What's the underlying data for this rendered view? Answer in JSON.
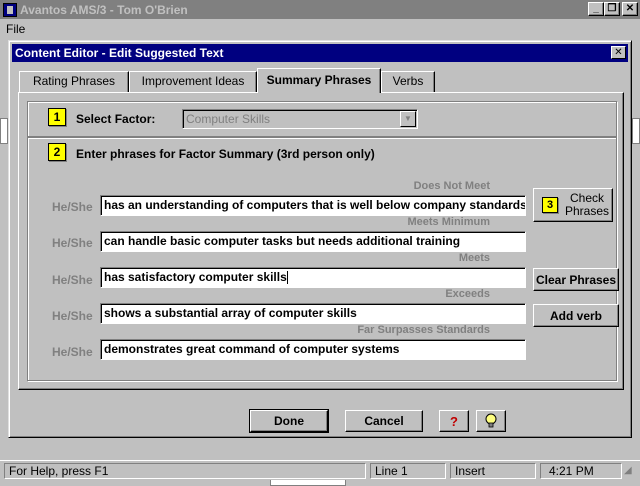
{
  "app": {
    "title": "Avantos AMS/3 - Tom O'Brien",
    "menu": {
      "file": "File"
    },
    "window_buttons": {
      "minimize": "_",
      "restore": "❐",
      "close": "✕"
    }
  },
  "dialog": {
    "title": "Content Editor - Edit Suggested Text",
    "close": "✕",
    "tabs": [
      {
        "label": "Rating Phrases",
        "active": false
      },
      {
        "label": "Improvement Ideas",
        "active": false
      },
      {
        "label": "Summary Phrases",
        "active": true
      },
      {
        "label": "Verbs",
        "active": false
      }
    ],
    "step1": {
      "number": "1",
      "label": "Select Factor:",
      "value": "Computer Skills"
    },
    "step2": {
      "number": "2",
      "label": "Enter phrases for Factor Summary (3rd person only)"
    },
    "pronoun": "He/She",
    "phrases": [
      {
        "level": "Does Not Meet",
        "text": "has an understanding of computers that is well below company standards"
      },
      {
        "level": "Meets Minimum",
        "text": "can handle basic computer tasks but needs additional training"
      },
      {
        "level": "Meets",
        "text": "has satisfactory computer skills"
      },
      {
        "level": "Exceeds",
        "text": "shows a substantial array of computer skills"
      },
      {
        "level": "Far Surpasses Standards",
        "text": "demonstrates great command of computer systems"
      }
    ],
    "side_buttons": {
      "check_number": "3",
      "check_line1": "Check",
      "check_line2": "Phrases",
      "clear": "Clear Phrases",
      "add_verb": "Add verb"
    },
    "footer": {
      "done": "Done",
      "cancel": "Cancel",
      "help": "?",
      "tip_icon": "lightbulb-icon"
    }
  },
  "statusbar": {
    "help": "For Help, press F1",
    "line": "Line 1",
    "mode": "Insert",
    "time": "4:21 PM"
  },
  "colors": {
    "title_active": "#000080",
    "badge": "#ffff00",
    "face": "#c0c0c0"
  }
}
